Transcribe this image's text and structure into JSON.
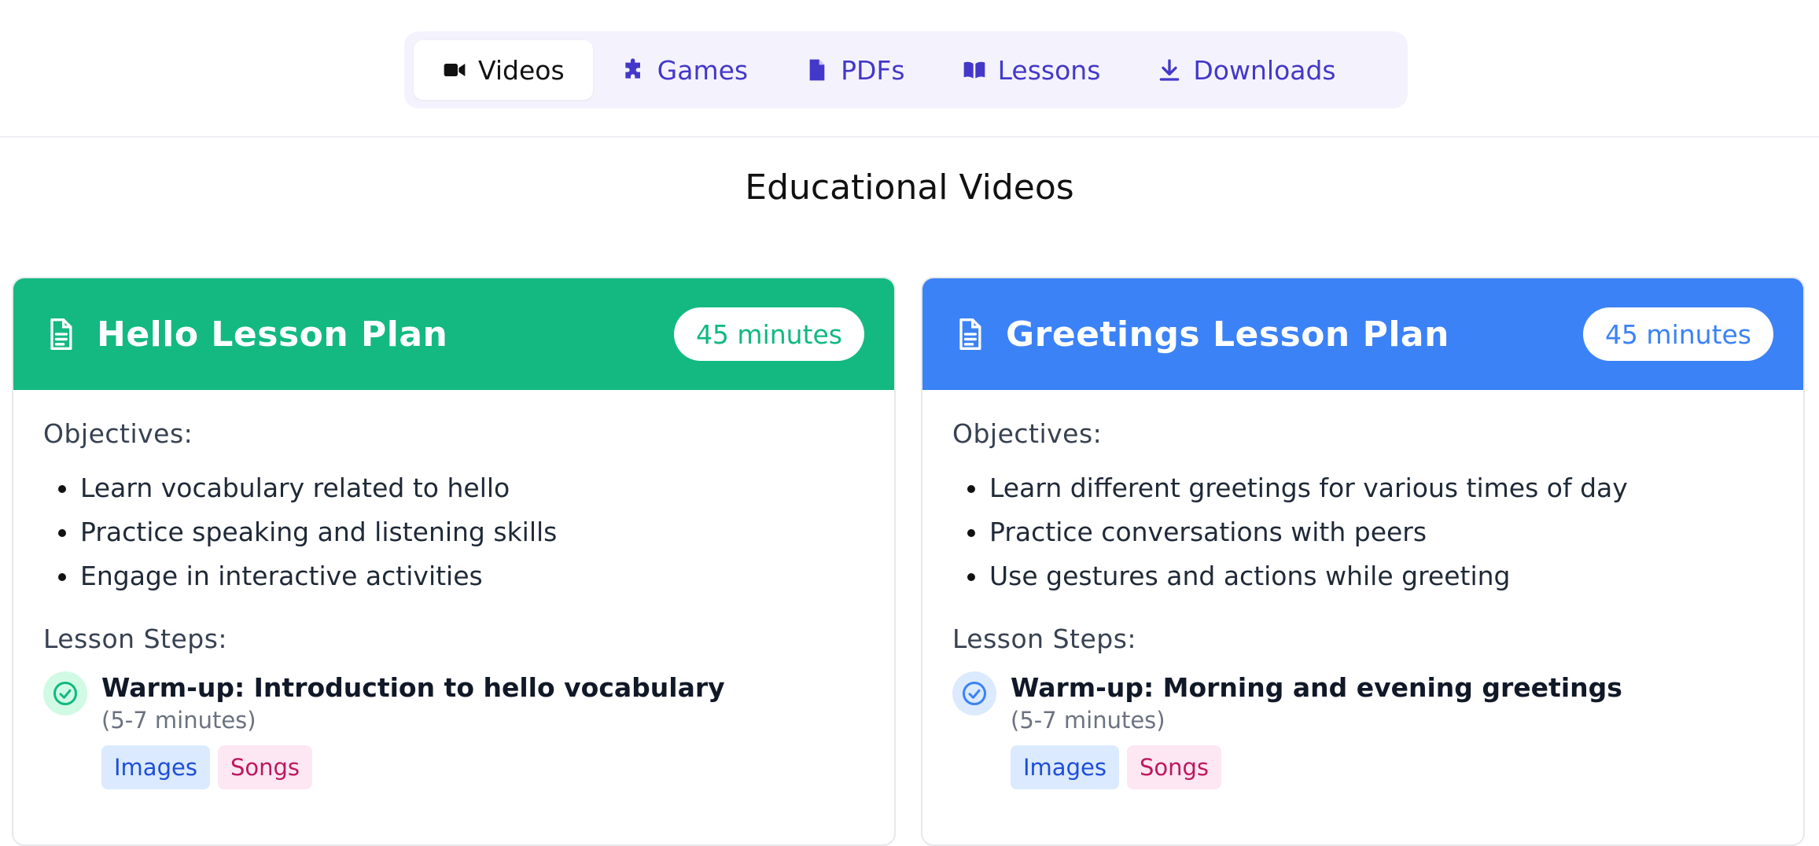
{
  "nav": {
    "tabs": [
      {
        "label": "Videos",
        "icon": "video-icon",
        "active": true
      },
      {
        "label": "Games",
        "icon": "puzzle-icon",
        "active": false
      },
      {
        "label": "PDFs",
        "icon": "file-icon",
        "active": false
      },
      {
        "label": "Lessons",
        "icon": "book-open-icon",
        "active": false
      },
      {
        "label": "Downloads",
        "icon": "download-icon",
        "active": false
      }
    ]
  },
  "page": {
    "title": "Educational Videos"
  },
  "cards": [
    {
      "title": "Hello Lesson Plan",
      "duration": "45 minutes",
      "accent": "#13b981",
      "objectives_label": "Objectives:",
      "objectives": [
        "Learn vocabulary related to hello",
        "Practice speaking and listening skills",
        "Engage in interactive activities"
      ],
      "steps_label": "Lesson Steps:",
      "steps": [
        {
          "title": "Warm-up: Introduction to hello vocabulary",
          "duration": "(5-7 minutes)",
          "tags": [
            "Images",
            "Songs"
          ]
        }
      ]
    },
    {
      "title": "Greetings Lesson Plan",
      "duration": "45 minutes",
      "accent": "#3b82f6",
      "objectives_label": "Objectives:",
      "objectives": [
        "Learn different greetings for various times of day",
        "Practice conversations with peers",
        "Use gestures and actions while greeting"
      ],
      "steps_label": "Lesson Steps:",
      "steps": [
        {
          "title": "Warm-up: Morning and evening greetings",
          "duration": "(5-7 minutes)",
          "tags": [
            "Images",
            "Songs"
          ]
        }
      ]
    }
  ]
}
